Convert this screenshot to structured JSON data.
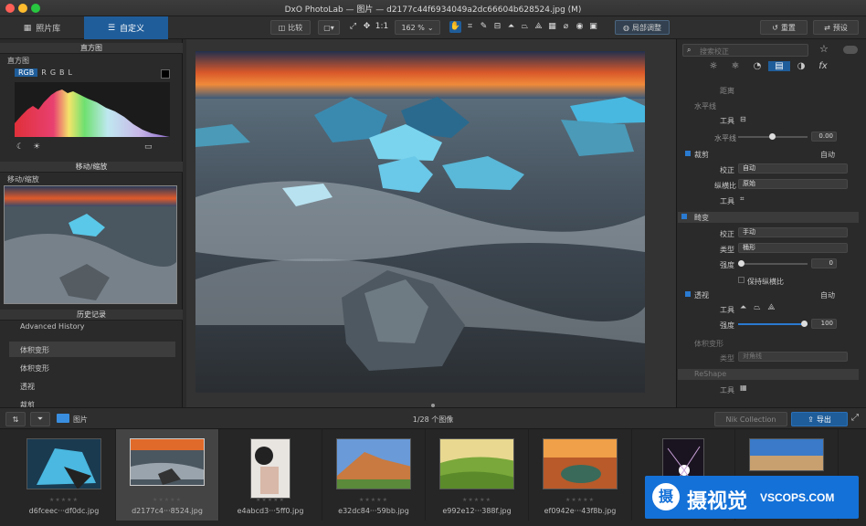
{
  "window": {
    "title": "DxO PhotoLab — 图片 — d2177c44f6934049a2dc66604b628524.jpg (M)"
  },
  "tabs": {
    "library": "照片库",
    "customize": "自定义"
  },
  "toolbar": {
    "compare": "比较",
    "one_to_one": "1:1",
    "zoom": "162 %",
    "local_adjust": "局部调整",
    "reset": "重置",
    "preset": "预设"
  },
  "left": {
    "histogram": {
      "title": "直方图",
      "subtitle": "直方图",
      "channels": [
        "RGB",
        "R",
        "G",
        "B",
        "L"
      ]
    },
    "move_zoom": {
      "title": "移动/缩放",
      "subtitle": "移动/缩放"
    },
    "history": {
      "title": "历史记录",
      "subtitle": "Advanced History",
      "items": [
        "体积变形",
        "体积变形",
        "透视",
        "裁剪"
      ]
    }
  },
  "right": {
    "search_placeholder": "搜索校正",
    "distance_label": "距离",
    "horizon": {
      "title": "水平线",
      "tool_label": "工具",
      "slider_label": "水平线",
      "value": "0.00"
    },
    "crop": {
      "title": "裁剪",
      "auto": "自动",
      "correction_label": "校正",
      "correction_value": "自动",
      "ratio_label": "纵横比",
      "ratio_value": "原始",
      "tool_label": "工具"
    },
    "vignette": {
      "title": "畸变",
      "correction_label": "校正",
      "correction_value": "手动",
      "type_label": "类型",
      "type_value": "桶形",
      "strength_label": "强度",
      "strength_value": "0",
      "keep_ratio": "保持纵横比"
    },
    "perspective": {
      "title": "透视",
      "auto": "自动",
      "tool_label": "工具",
      "strength_label": "强度",
      "strength_value": "100"
    },
    "volume": {
      "title": "体积变形",
      "type_label": "类型",
      "type_value": "对角线"
    },
    "reshape": {
      "title": "ReShape",
      "tool_label": "工具"
    }
  },
  "bottom": {
    "folder": "图片",
    "count": "1/28 个图像",
    "nik": "Nik Collection",
    "export": "导出"
  },
  "filmstrip": [
    {
      "name": "d6fceec···df0dc.jpg"
    },
    {
      "name": "d2177c4···8524.jpg"
    },
    {
      "name": "e4abcd3···5ff0.jpg"
    },
    {
      "name": "e32dc84···59bb.jpg"
    },
    {
      "name": "e992e12···388f.jpg"
    },
    {
      "name": "ef0942e···43f8b.jpg"
    },
    {
      "name": ""
    },
    {
      "name": ""
    }
  ],
  "watermark": {
    "cn": "摄视觉",
    "domain": "VSCOPS.COM"
  }
}
